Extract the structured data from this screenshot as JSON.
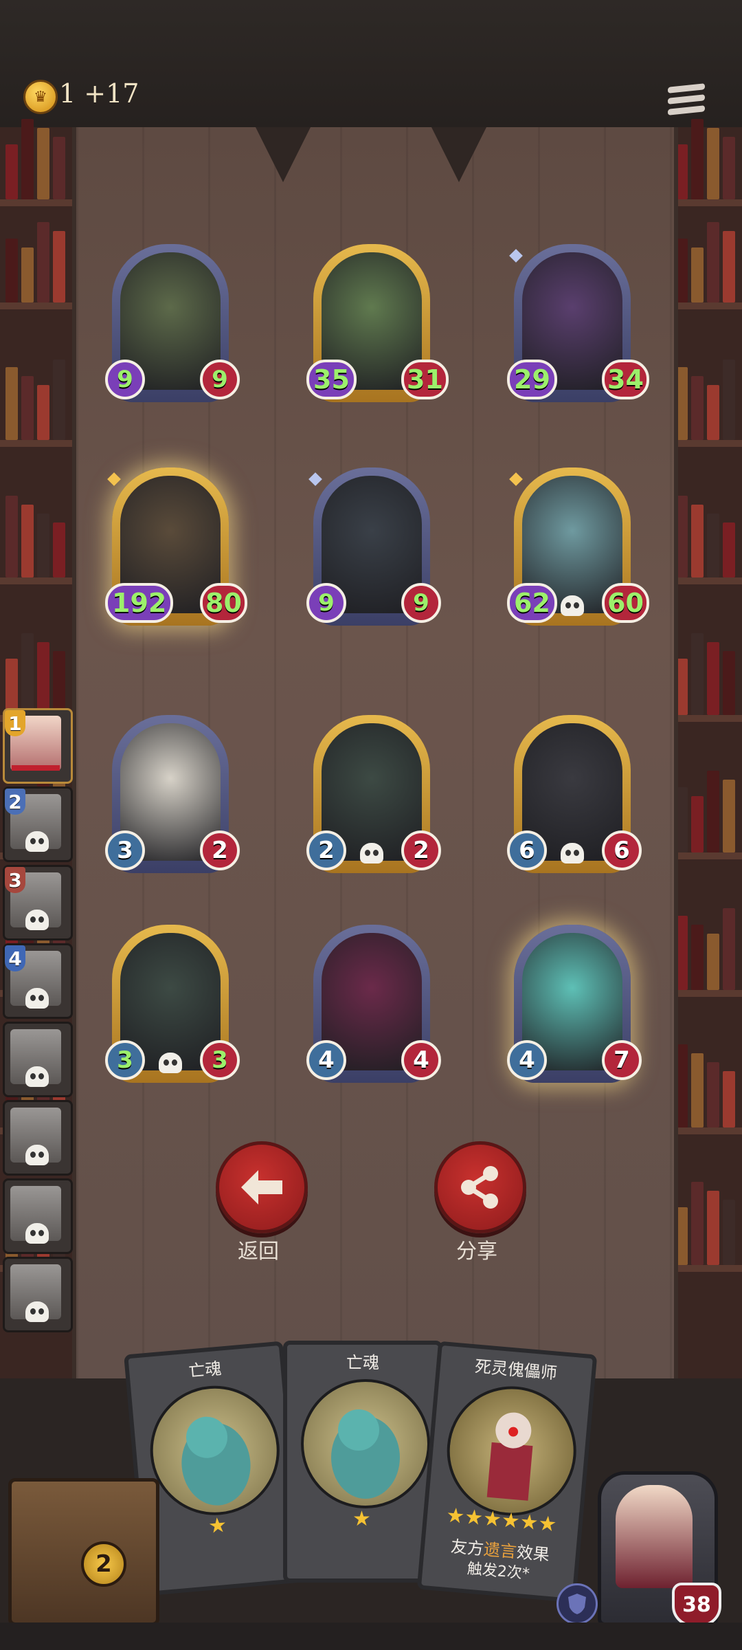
{
  "header": {
    "coins_label": "1 +17",
    "coin_icon": "crown-coin-icon",
    "menu_icon": "menu-icon"
  },
  "board": {
    "minions": [
      {
        "atk": "9",
        "hp": "9",
        "frame": "blue",
        "atk_style": "purple",
        "buffed": true,
        "skull": false,
        "art": "goblin-witch"
      },
      {
        "atk": "35",
        "hp": "31",
        "frame": "gold",
        "atk_style": "purple",
        "buffed": true,
        "skull": false,
        "art": "green-flame-knight"
      },
      {
        "atk": "29",
        "hp": "34",
        "frame": "blue",
        "atk_style": "purple",
        "buffed": true,
        "skull": false,
        "art": "octopus-pirate"
      },
      {
        "atk": "192",
        "hp": "80",
        "frame": "gold",
        "atk_style": "purple",
        "buffed": true,
        "skull": false,
        "art": "rat-beast"
      },
      {
        "atk": "9",
        "hp": "9",
        "frame": "blue",
        "atk_style": "purple",
        "buffed": true,
        "skull": false,
        "art": "black-panther"
      },
      {
        "atk": "62",
        "hp": "60",
        "frame": "gold",
        "atk_style": "purple",
        "buffed": true,
        "skull": true,
        "art": "ice-goblin"
      },
      {
        "atk": "3",
        "hp": "2",
        "frame": "blue",
        "atk_style": "blue",
        "buffed": false,
        "skull": false,
        "art": "patchwork-dog"
      },
      {
        "atk": "2",
        "hp": "2",
        "frame": "gold",
        "atk_style": "blue",
        "buffed": false,
        "skull": true,
        "art": "mimic-chest"
      },
      {
        "atk": "6",
        "hp": "6",
        "frame": "gold",
        "atk_style": "blue",
        "buffed": false,
        "skull": true,
        "art": "hooded-rogue"
      },
      {
        "atk": "3",
        "hp": "3",
        "frame": "gold",
        "atk_style": "blue",
        "buffed": true,
        "skull": true,
        "art": "mimic-chest"
      },
      {
        "atk": "4",
        "hp": "4",
        "frame": "blue",
        "atk_style": "blue",
        "buffed": false,
        "skull": false,
        "art": "jester-puppet"
      },
      {
        "atk": "4",
        "hp": "7",
        "frame": "blue",
        "atk_style": "blue",
        "buffed": false,
        "skull": false,
        "art": "ghost-ogre"
      }
    ]
  },
  "sidebar": {
    "players": [
      {
        "rank": "1",
        "active": true
      },
      {
        "rank": "2",
        "active": false
      },
      {
        "rank": "3",
        "active": false
      },
      {
        "rank": "4",
        "active": false
      },
      {
        "rank": "",
        "active": false
      },
      {
        "rank": "",
        "active": false
      },
      {
        "rank": "",
        "active": false
      },
      {
        "rank": "",
        "active": false
      }
    ]
  },
  "actions": {
    "back_label": "返回",
    "back_icon": "arrow-left-icon",
    "share_label": "分享",
    "share_icon": "share-icon"
  },
  "hand": {
    "cards": [
      {
        "title": "亡魂",
        "stars": 1,
        "desc": ""
      },
      {
        "title": "亡魂",
        "stars": 1,
        "desc": ""
      },
      {
        "title": "死灵傀儡师",
        "stars": 6,
        "desc_prefix": "友方",
        "desc_keyword": "遗言",
        "desc_suffix": "效果",
        "desc_line2": "触发2次*"
      }
    ]
  },
  "deck": {
    "count": "2"
  },
  "hero": {
    "hp": "38",
    "shield_icon": "shield-icon"
  },
  "colors": {
    "gold_frame": "#d9a63c",
    "blue_frame": "#555a86",
    "hp_red": "#b3263b",
    "atk_blue": "#3f6e9b",
    "atk_purple": "#7a3fb8",
    "buff_green": "#9cf06b",
    "button_red": "#b42a29"
  }
}
